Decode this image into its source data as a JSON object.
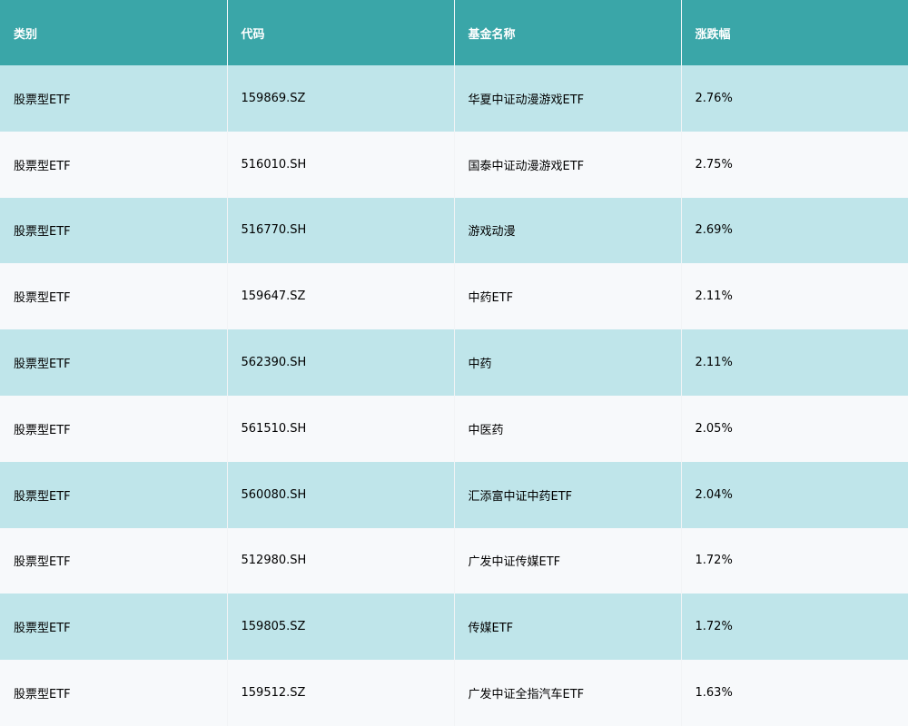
{
  "table": {
    "headers": [
      "类别",
      "代码",
      "基金名称",
      "涨跌幅"
    ],
    "rows": [
      [
        "股票型ETF",
        "159869.SZ",
        "华夏中证动漫游戏ETF",
        "2.76%"
      ],
      [
        "股票型ETF",
        "516010.SH",
        "国泰中证动漫游戏ETF",
        "2.75%"
      ],
      [
        "股票型ETF",
        "516770.SH",
        "游戏动漫",
        "2.69%"
      ],
      [
        "股票型ETF",
        "159647.SZ",
        "中药ETF",
        "2.11%"
      ],
      [
        "股票型ETF",
        "562390.SH",
        "中药",
        "2.11%"
      ],
      [
        "股票型ETF",
        "561510.SH",
        "中医药",
        "2.05%"
      ],
      [
        "股票型ETF",
        "560080.SH",
        "汇添富中证中药ETF",
        "2.04%"
      ],
      [
        "股票型ETF",
        "512980.SH",
        "广发中证传媒ETF",
        "1.72%"
      ],
      [
        "股票型ETF",
        "159805.SZ",
        "传媒ETF",
        "1.72%"
      ],
      [
        "股票型ETF",
        "159512.SZ",
        "广发中证全指汽车ETF",
        "1.63%"
      ]
    ]
  },
  "colors": {
    "header_bg": "#3aa6a8",
    "row_odd_bg": "#bfe5ea",
    "row_even_bg": "#f7f9fb",
    "header_text": "#ffffff",
    "cell_text": "#000000"
  }
}
